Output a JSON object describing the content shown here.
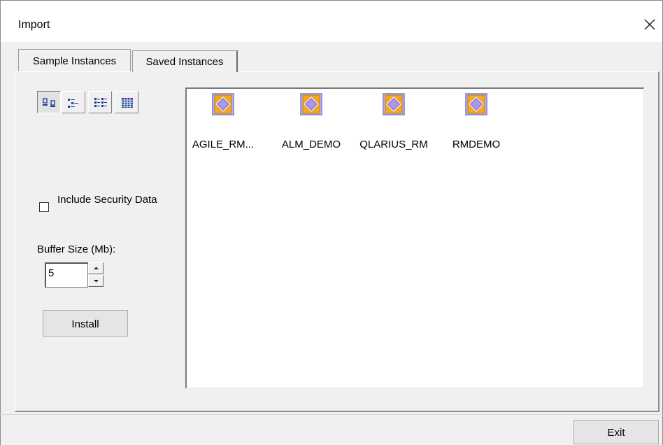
{
  "window": {
    "title": "Import"
  },
  "tabs": [
    {
      "label": "Sample Instances",
      "selected": true
    },
    {
      "label": "Saved Instances",
      "selected": false
    }
  ],
  "view_buttons": [
    {
      "icon": "large-icons-view-icon",
      "pressed": true
    },
    {
      "icon": "small-icons-view-icon",
      "pressed": false
    },
    {
      "icon": "list-view-icon",
      "pressed": false
    },
    {
      "icon": "details-view-icon",
      "pressed": false
    }
  ],
  "instances": [
    {
      "label": "AGILE_RM...",
      "icon": "database-instance-icon"
    },
    {
      "label": "ALM_DEMO",
      "icon": "database-instance-icon"
    },
    {
      "label": "QLARIUS_RM",
      "icon": "database-instance-icon"
    },
    {
      "label": "RMDEMO",
      "icon": "database-instance-icon"
    }
  ],
  "options": {
    "include_security_label": "Include Security Data",
    "include_security_checked": false,
    "buffer_label": "Buffer Size (Mb):",
    "buffer_value": "5"
  },
  "buttons": {
    "install": "Install",
    "exit": "Exit"
  },
  "colors": {
    "icon_frame": "#a9a9ea",
    "icon_core": "#f5a623",
    "icon_diamond": "#8878d8"
  }
}
